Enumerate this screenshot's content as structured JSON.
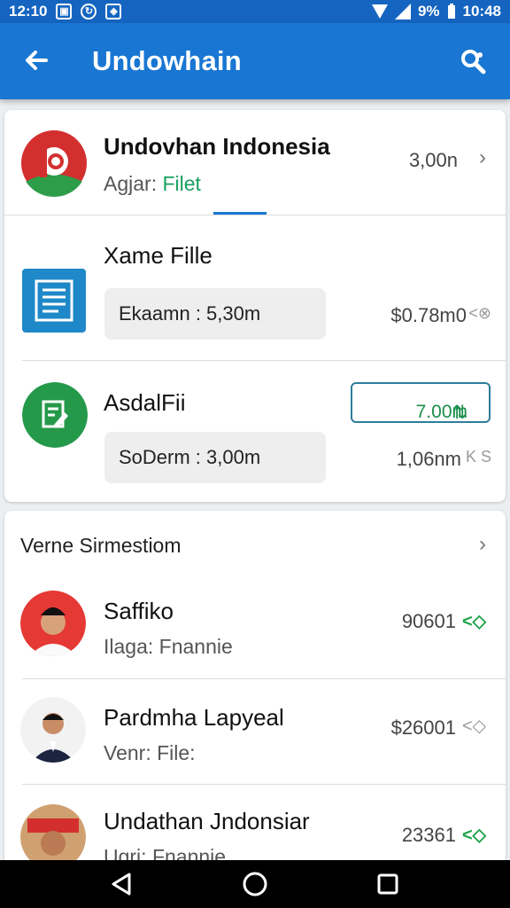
{
  "status_bar": {
    "time_left": "12:10",
    "battery": "9%",
    "time_right": "10:48"
  },
  "app_bar": {
    "title": "Undowhain",
    "back_glyph": "←"
  },
  "card1": {
    "header": {
      "title": "Undovhan Indonesia",
      "subtitle_label": "Agjar:",
      "subtitle_value": "Filet",
      "amount": "3,00n",
      "chevron": "›"
    },
    "items": [
      {
        "title": "Xame Fille",
        "detail": "Ekaamn : 5,30m",
        "amount": "$0.78m0",
        "trail": "<⊗"
      },
      {
        "title": "AsdalFii",
        "detail": "SoDerm : 3,00m",
        "button": "7.00m",
        "button_icon": "⇅",
        "amount": "1,06nm",
        "trail": "K S"
      }
    ]
  },
  "card2": {
    "header": "Verne Sirmestiom",
    "chevron": "›",
    "people": [
      {
        "name": "Saffiko",
        "sub_label": "Ilaga:",
        "sub_value": "Fnannie",
        "amount": "90601",
        "trail": "<◇"
      },
      {
        "name": "Pardmha Lapyeal",
        "sub_label": "Venr:",
        "sub_value": "File:",
        "amount": "$26001",
        "trail": "<◇"
      },
      {
        "name": "Undathan Jndonsiar",
        "sub_label": "Ugri:",
        "sub_value": "Fnannie",
        "amount": "23361",
        "trail": "<◇"
      }
    ]
  },
  "colors": {
    "app_bar": "#1976d2",
    "status_bar": "#1565c0",
    "accent_green": "#17a05d",
    "card_bg": "#ffffff",
    "page_bg": "#eceff1"
  },
  "icons": {
    "back": "arrow-left-icon",
    "search": "search-icon",
    "nav_back": "triangle-back-icon",
    "nav_home": "circle-home-icon",
    "nav_recent": "square-recent-icon"
  }
}
